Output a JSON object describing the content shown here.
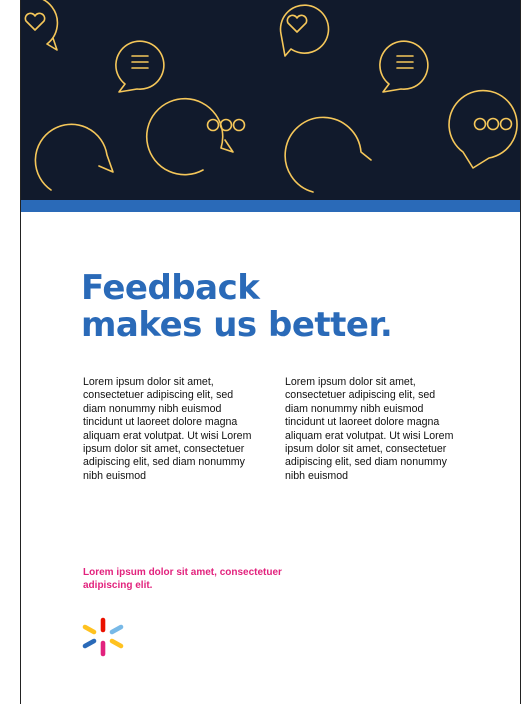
{
  "document": {
    "headline": {
      "line1": "Feedback",
      "line2": "makes us better."
    },
    "columns": [
      "Lorem ipsum dolor sit amet, consectetuer adipiscing elit, sed diam nonummy nibh euismod tincidunt ut laoreet dolore magna aliquam erat volutpat. Ut wisi Lorem ipsum dolor sit amet, consectetuer adipiscing elit, sed diam nonummy nibh euismod",
      "Lorem ipsum dolor sit amet, consectetuer adipiscing elit, sed diam nonummy nibh euismod tincidunt ut laoreet dolore magna aliquam erat volutpat. Ut wisi Lorem ipsum dolor sit amet, consectetuer adipiscing elit, sed diam nonummy nibh euismod"
    ],
    "callout": "Lorem ipsum dolor sit amet, consectetuer adipiscing elit."
  },
  "hero": {
    "icons": [
      "heart-bubble-icon",
      "message-lines-bubble-icon",
      "ellipsis-bubble-icon"
    ]
  },
  "colors": {
    "hero_background": "#111a2c",
    "icon_stroke": "#f5c75a",
    "brand_blue": "#2a6ab8",
    "callout_pink": "#e2227d",
    "spark_yellow": "#ffc220",
    "spark_light_blue": "#78b9e7",
    "spark_magenta": "#e2227d",
    "spark_blue": "#2a6ab8",
    "spark_red": "#ea1100"
  }
}
